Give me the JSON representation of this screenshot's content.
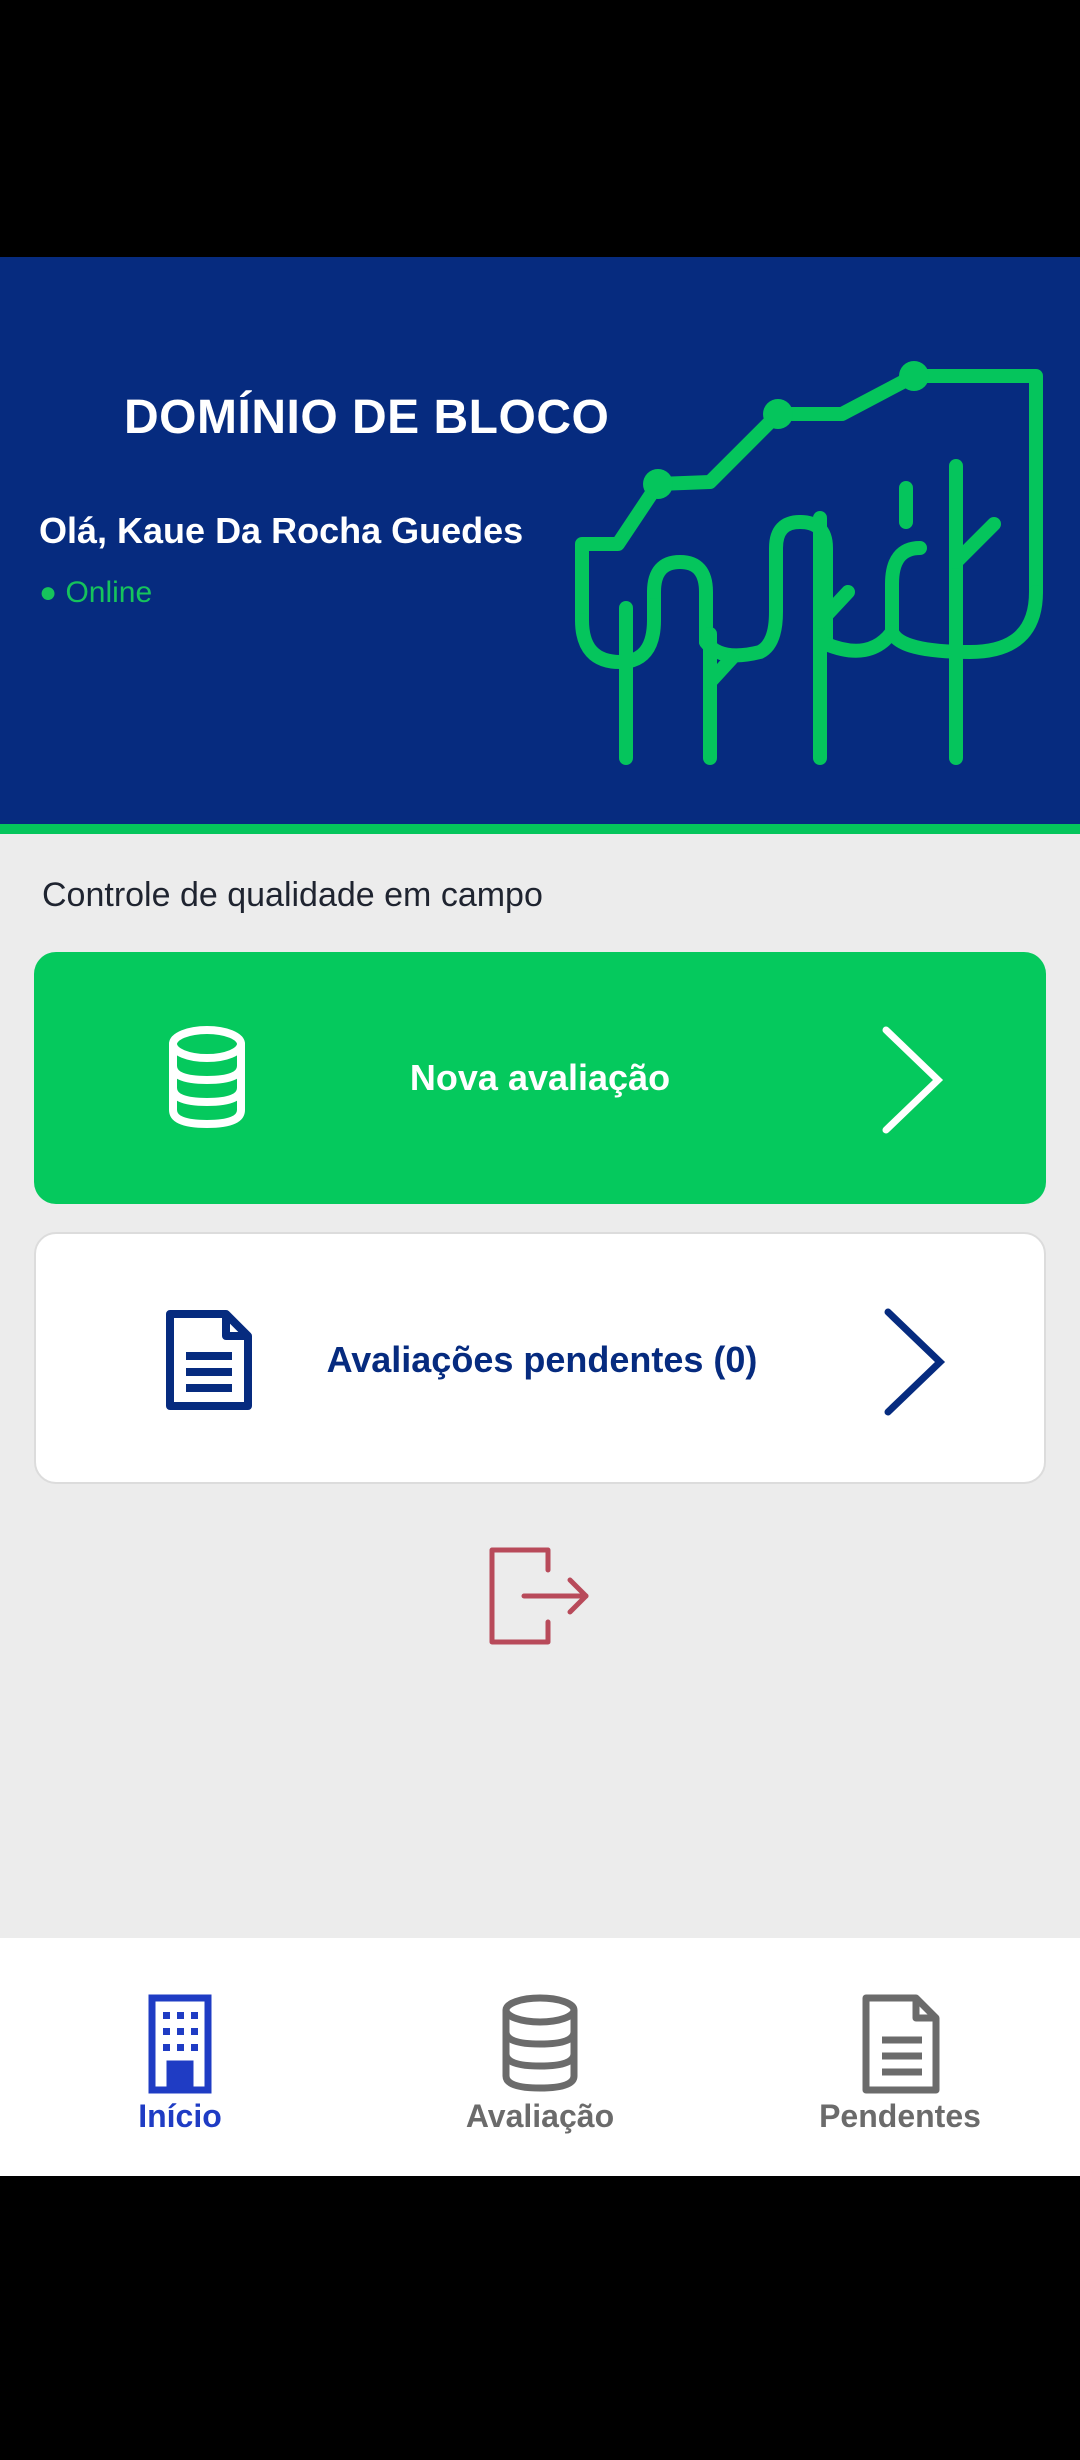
{
  "header": {
    "app_title": "DOMÍNIO DE BLOCO",
    "greeting": "Olá, Kaue Da Rocha Guedes",
    "status": "● Online"
  },
  "main": {
    "section_title": "Controle de qualidade em campo",
    "cards": [
      {
        "label": "Nova avaliação",
        "icon": "database-icon"
      },
      {
        "label": "Avaliações pendentes (0)",
        "icon": "document-icon"
      }
    ],
    "logout_icon": "logout-icon"
  },
  "bottom_nav": {
    "items": [
      {
        "label": "Início",
        "icon": "building-icon",
        "active": true
      },
      {
        "label": "Avaliação",
        "icon": "database-icon",
        "active": false
      },
      {
        "label": "Pendentes",
        "icon": "document-icon",
        "active": false
      }
    ]
  },
  "colors": {
    "header_blue": "#062b7f",
    "accent_green": "#05c95d",
    "nav_active": "#1f3cc4",
    "logout_red": "#b84a5a"
  }
}
